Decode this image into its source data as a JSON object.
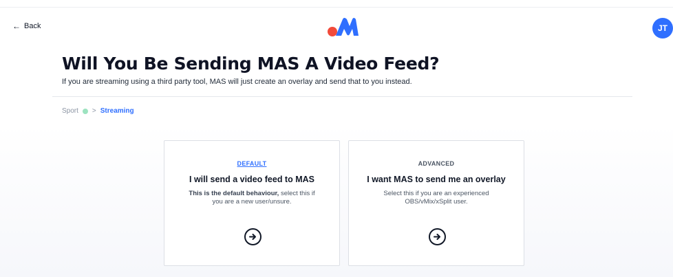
{
  "header": {
    "back_label": "Back",
    "avatar_initials": "JT"
  },
  "hero": {
    "title": "Will You Be Sending MAS A Video Feed?",
    "subtitle": "If you are streaming using a third party tool, MAS will just create an overlay and send that to you instead."
  },
  "breadcrumb": {
    "step1": "Sport",
    "separator": ">",
    "current": "Streaming"
  },
  "options": [
    {
      "tag": "DEFAULT",
      "title": "I will send a video feed to MAS",
      "desc_bold": "This is the default behaviour,",
      "desc_rest": " select this if you are a new user/unsure."
    },
    {
      "tag": "ADVANCED",
      "title": "I want MAS to send me an overlay",
      "desc": "Select this if you are an experienced OBS/vMix/xSplit user."
    }
  ],
  "colors": {
    "accent": "#2f6fff",
    "logo_red": "#f24a3a",
    "logo_blue": "#2f6fff",
    "check": "#9de3c0"
  },
  "icons": {
    "back": "arrow-left-icon",
    "option_go": "arrow-right-circle-icon",
    "crumb_done": "check-dot-icon"
  }
}
